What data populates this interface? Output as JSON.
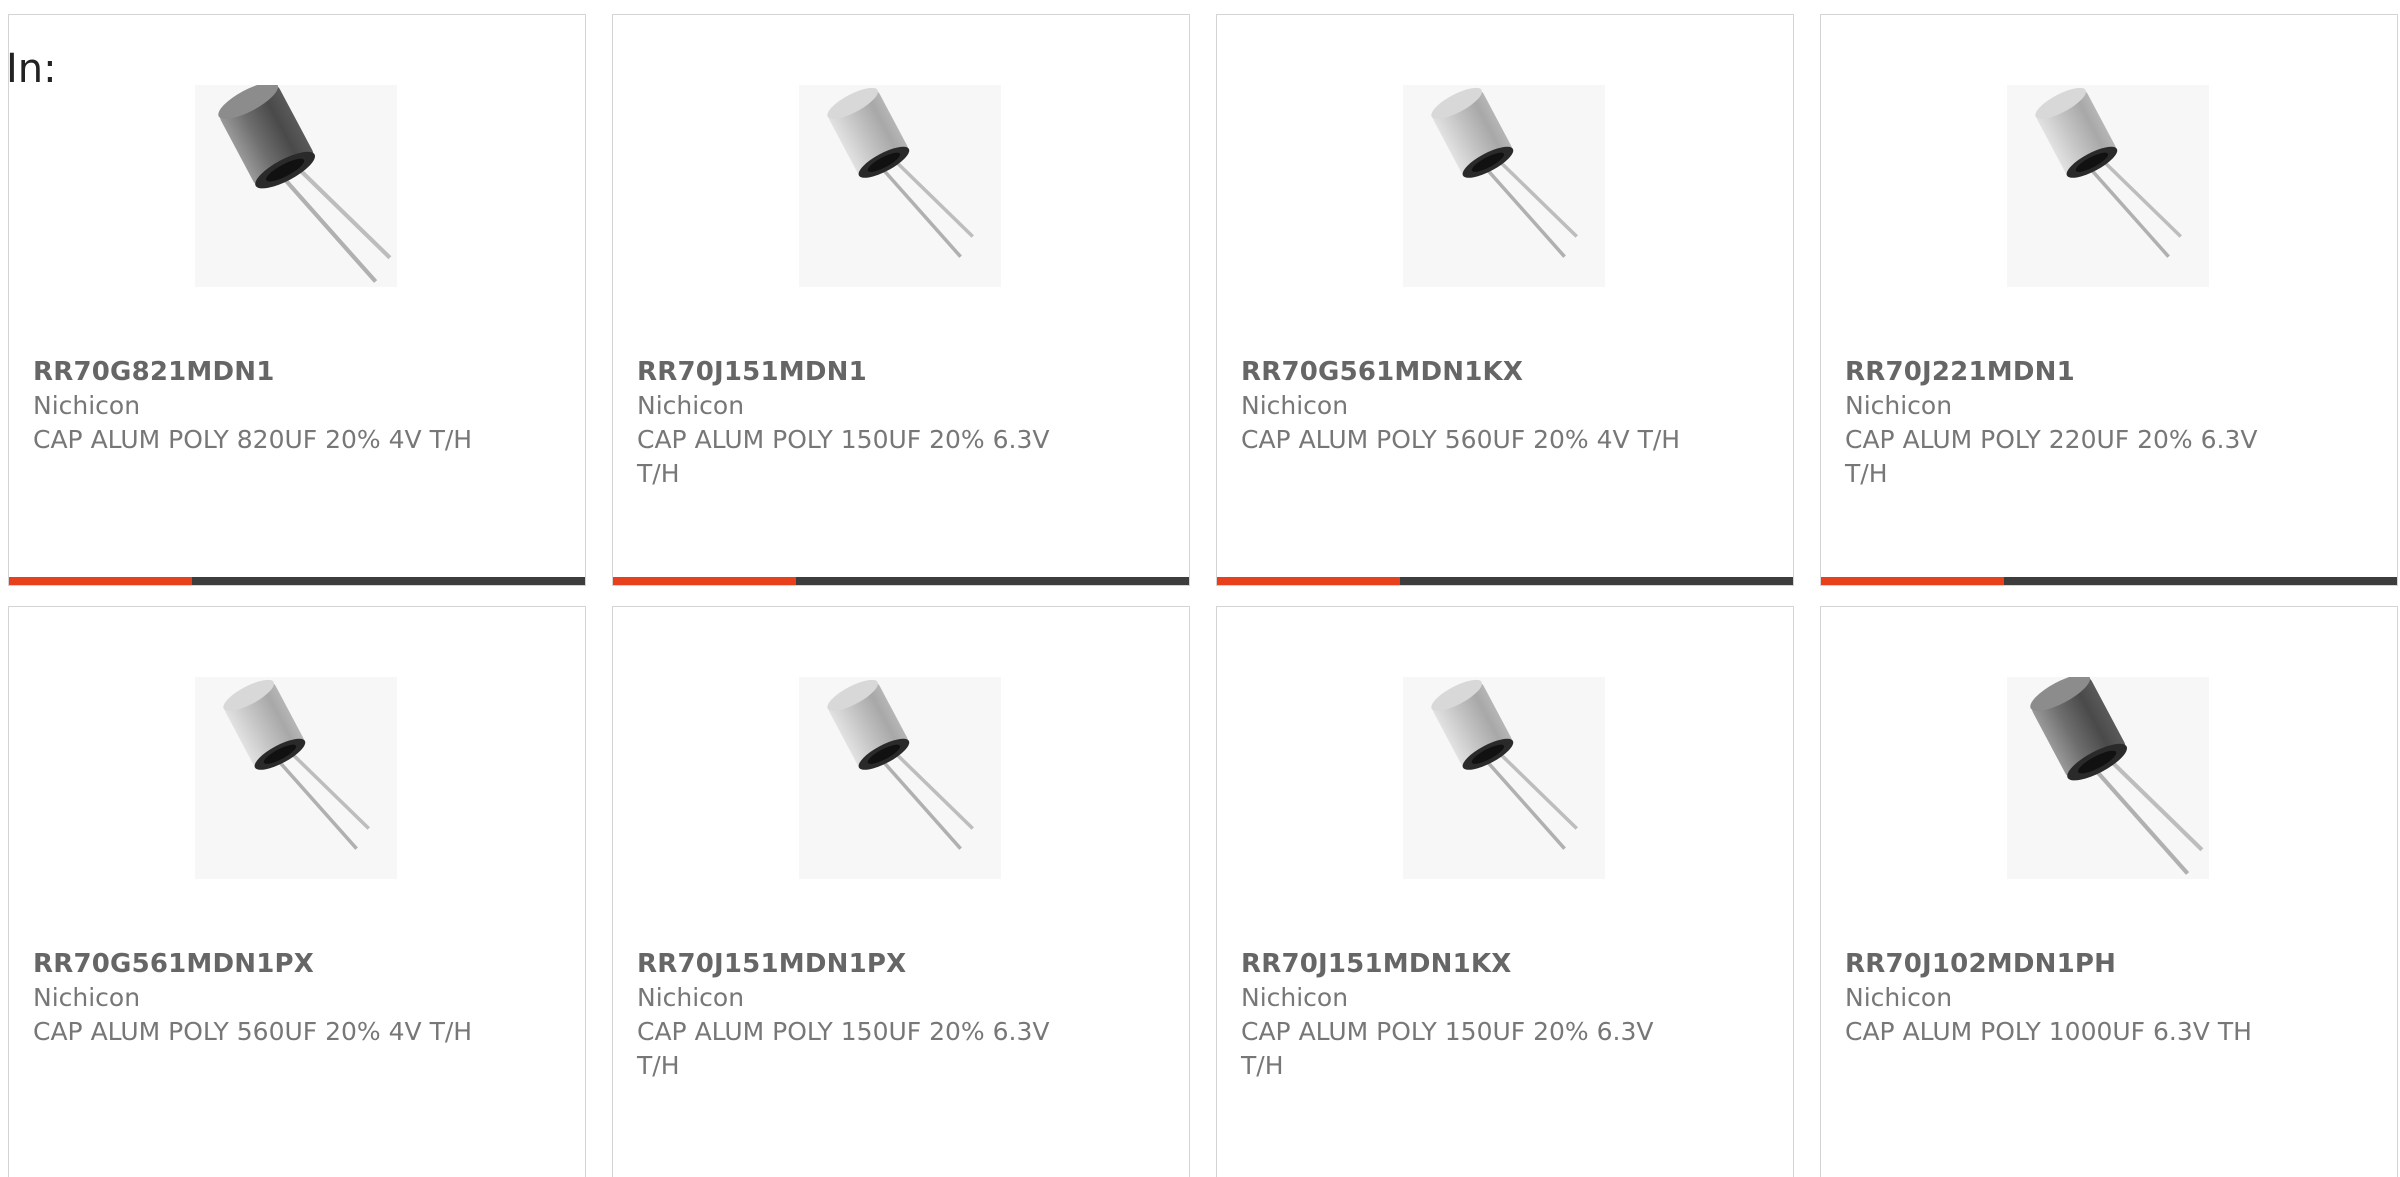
{
  "filter": {
    "label": "In:"
  },
  "colors": {
    "accent": "#e8401c",
    "bar": "#3d3d3d",
    "border": "#d4d4d4"
  },
  "products": [
    {
      "part_number": "RR70G821MDN1",
      "manufacturer": "Nichicon",
      "description": "CAP ALUM POLY 820UF 20% 4V T/H",
      "image_variant": "dark-large",
      "show_accent_bar": true
    },
    {
      "part_number": "RR70J151MDN1",
      "manufacturer": "Nichicon",
      "description": "CAP ALUM POLY 150UF 20% 6.3V T/H",
      "image_variant": "light-small",
      "show_accent_bar": true
    },
    {
      "part_number": "RR70G561MDN1KX",
      "manufacturer": "Nichicon",
      "description": "CAP ALUM POLY 560UF 20% 4V T/H",
      "image_variant": "light-small",
      "show_accent_bar": true
    },
    {
      "part_number": "RR70J221MDN1",
      "manufacturer": "Nichicon",
      "description": "CAP ALUM POLY 220UF 20% 6.3V T/H",
      "image_variant": "light-small",
      "show_accent_bar": true
    },
    {
      "part_number": "RR70G561MDN1PX",
      "manufacturer": "Nichicon",
      "description": "CAP ALUM POLY 560UF 20% 4V T/H",
      "image_variant": "light-small",
      "show_accent_bar": false
    },
    {
      "part_number": "RR70J151MDN1PX",
      "manufacturer": "Nichicon",
      "description": "CAP ALUM POLY 150UF 20% 6.3V T/H",
      "image_variant": "light-small",
      "show_accent_bar": false
    },
    {
      "part_number": "RR70J151MDN1KX",
      "manufacturer": "Nichicon",
      "description": "CAP ALUM POLY 150UF 20% 6.3V T/H",
      "image_variant": "light-small",
      "show_accent_bar": false
    },
    {
      "part_number": "RR70J102MDN1PH",
      "manufacturer": "Nichicon",
      "description": "CAP ALUM POLY 1000UF 6.3V TH",
      "image_variant": "dark-large",
      "show_accent_bar": false
    }
  ]
}
